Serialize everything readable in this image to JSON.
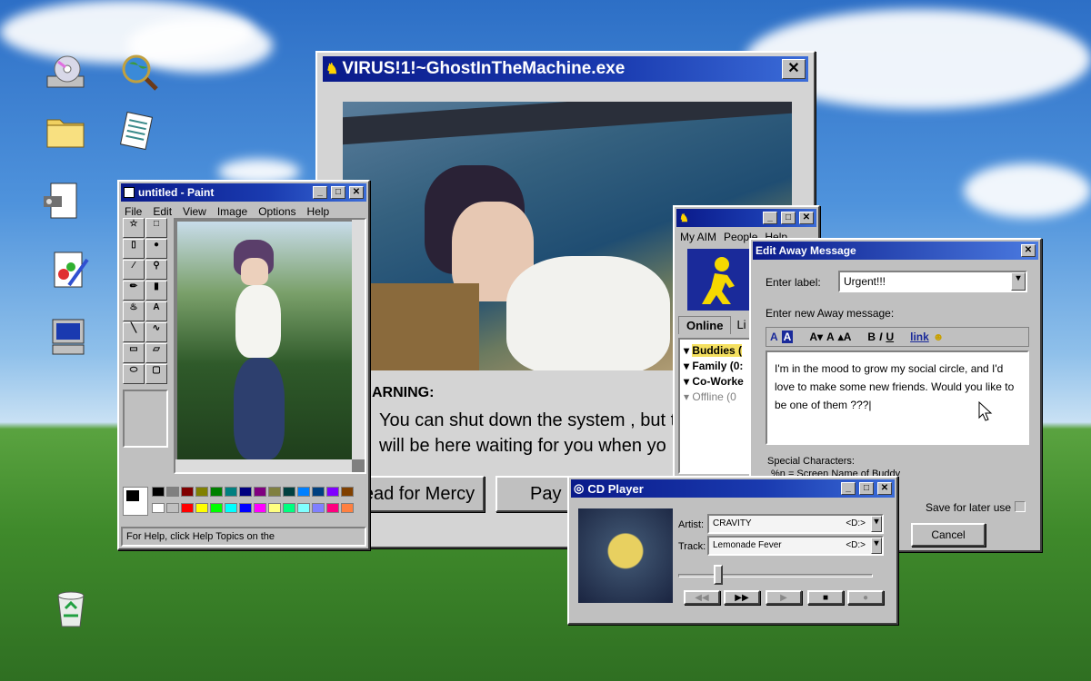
{
  "virus_window": {
    "title": "VIRUS!1!~GhostInTheMachine.exe",
    "warning_title": "ARNING:",
    "warning_line1": "You can shut down the system , but t",
    "warning_line2": "will be here waiting for you when yo",
    "button_plead": "ead for Mercy",
    "button_pay": "Pay N"
  },
  "paint": {
    "title": "untitled - Paint",
    "menu": [
      "File",
      "Edit",
      "View",
      "Image",
      "Options",
      "Help"
    ],
    "status": "For Help, click Help Topics on the"
  },
  "aim": {
    "menu": [
      "My AIM",
      "People",
      "Help"
    ],
    "tabs": [
      "Online",
      "Li"
    ],
    "groups": [
      "Buddies (",
      "Family (0:",
      "Co-Worke",
      "Offline (0"
    ]
  },
  "away": {
    "title": "Edit Away Message",
    "label_caption": "Enter label:",
    "label_value": "Urgent!!!",
    "message_caption": "Enter new Away message:",
    "link_label": "link",
    "message": "I'm in the mood to grow my social circle, and I'd love to make some new friends. Would you like to be one of them ???|",
    "special_caption": "Special Characters:",
    "special_line": "%n  = Screen Name of Buddy",
    "save_label": "Save for later use",
    "cancel_label": "Cancel"
  },
  "cd": {
    "title": "CD Player",
    "artist_caption": "Artist:",
    "artist": "CRAVITY",
    "track_caption": "Track:",
    "track": "Lemonade Fever",
    "disc_indicator": "<D:>",
    "progress": 0.18
  },
  "colors": {
    "titlebar": "#0a1a8a",
    "window": "#c0c0c0",
    "aim_yellow": "#f5d800"
  },
  "palette": [
    "#000000",
    "#808080",
    "#800000",
    "#808000",
    "#008000",
    "#008080",
    "#000080",
    "#800080",
    "#808040",
    "#004040",
    "#0080ff",
    "#004080",
    "#8000ff",
    "#804000",
    "#ffffff",
    "#c0c0c0",
    "#ff0000",
    "#ffff00",
    "#00ff00",
    "#00ffff",
    "#0000ff",
    "#ff00ff",
    "#ffff80",
    "#00ff80",
    "#80ffff",
    "#8080ff",
    "#ff0080",
    "#ff8040"
  ]
}
